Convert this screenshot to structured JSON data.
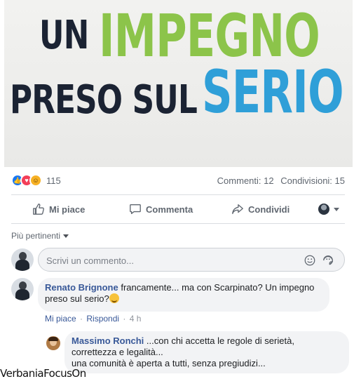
{
  "poster": {
    "line1_a": "UN",
    "line1_b": "IMPEGNO",
    "line2_a": "PRESO SUL",
    "line2_b": "SERIO"
  },
  "reactions": {
    "count": "115",
    "comments": "Commenti: 12",
    "shares": "Condivisioni: 15",
    "icons": [
      "like-icon",
      "love-icon",
      "haha-icon"
    ]
  },
  "actions": {
    "like": "Mi piace",
    "comment": "Commenta",
    "share": "Condividi"
  },
  "sort": {
    "label": "Più pertinenti"
  },
  "composer": {
    "placeholder": "Scrivi un commento..."
  },
  "comments": [
    {
      "author": "Renato Brignone",
      "text": "francamente... ma con Scarpinato? Un impegno preso sul serio?",
      "like_label": "Mi piace",
      "separator": "·",
      "reply_label": "Rispondi",
      "time": "4 h"
    },
    {
      "author": "Massimo Ronchi",
      "text_line1": "...con chi accetta le regole di serietà,",
      "text_line2": "correttezza e legalità...",
      "text_line3": "una comunità è aperta a tutti, senza pregiudizi..."
    }
  ],
  "watermark": "VerbaniaFocusOn",
  "colors": {
    "link_blue": "#385898",
    "brand_blue": "#1877f2",
    "poster_green": "#8cc44a",
    "poster_blue": "#2f9fd8",
    "poster_dark": "#1b2333"
  }
}
